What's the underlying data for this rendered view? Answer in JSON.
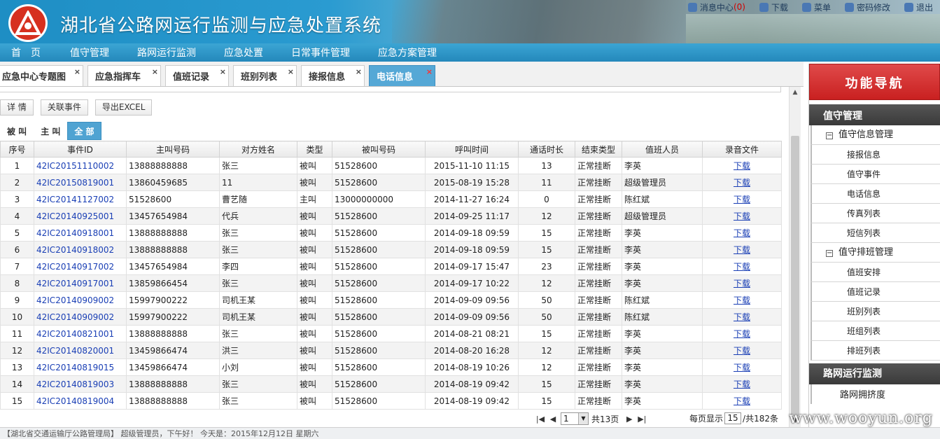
{
  "header": {
    "title": "湖北省公路网运行监测与应急处置系统",
    "toplinks": [
      {
        "label": "消息中心",
        "count": "(0)",
        "icon": "message-icon"
      },
      {
        "label": "下载",
        "icon": "download-icon"
      },
      {
        "label": "菜单",
        "icon": "menu-icon"
      },
      {
        "label": "密码修改",
        "icon": "lock-icon"
      },
      {
        "label": "退出",
        "icon": "exit-icon"
      }
    ]
  },
  "menu": [
    "首　页",
    "值守管理",
    "路网运行监测",
    "应急处置",
    "日常事件管理",
    "应急方案管理"
  ],
  "tabs": [
    "应急中心专题图",
    "应急指挥车",
    "值班记录",
    "班别列表",
    "接报信息",
    "电话信息"
  ],
  "toolbar": {
    "detail": "详 情",
    "related": "关联事件",
    "export": "导出EXCEL"
  },
  "subtabs": [
    "被 叫",
    "主 叫",
    "全 部"
  ],
  "table": {
    "headers": [
      "序号",
      "事件ID",
      "主叫号码",
      "对方姓名",
      "类型",
      "被叫号码",
      "呼叫时间",
      "通话时长",
      "结束类型",
      "值班人员",
      "录音文件"
    ],
    "rows": [
      [
        "1",
        "42IC20151110002",
        "13888888888",
        "张三",
        "被叫",
        "51528600",
        "2015-11-10 11:15",
        "13",
        "正常挂断",
        "李英",
        "下载"
      ],
      [
        "2",
        "42IC20150819001",
        "13860459685",
        "11",
        "被叫",
        "51528600",
        "2015-08-19 15:28",
        "11",
        "正常挂断",
        "超级管理员",
        "下载"
      ],
      [
        "3",
        "42IC20141127002",
        "51528600",
        "曹艺随",
        "主叫",
        "13000000000",
        "2014-11-27 16:24",
        "0",
        "正常挂断",
        "陈红斌",
        "下载"
      ],
      [
        "4",
        "42IC20140925001",
        "13457654984",
        "代兵",
        "被叫",
        "51528600",
        "2014-09-25 11:17",
        "12",
        "正常挂断",
        "超级管理员",
        "下载"
      ],
      [
        "5",
        "42IC20140918001",
        "13888888888",
        "张三",
        "被叫",
        "51528600",
        "2014-09-18 09:59",
        "15",
        "正常挂断",
        "李英",
        "下载"
      ],
      [
        "6",
        "42IC20140918002",
        "13888888888",
        "张三",
        "被叫",
        "51528600",
        "2014-09-18 09:59",
        "15",
        "正常挂断",
        "李英",
        "下载"
      ],
      [
        "7",
        "42IC20140917002",
        "13457654984",
        "李四",
        "被叫",
        "51528600",
        "2014-09-17 15:47",
        "23",
        "正常挂断",
        "李英",
        "下载"
      ],
      [
        "8",
        "42IC20140917001",
        "13859866454",
        "张三",
        "被叫",
        "51528600",
        "2014-09-17 10:22",
        "12",
        "正常挂断",
        "李英",
        "下载"
      ],
      [
        "9",
        "42IC20140909002",
        "15997900222",
        "司机王某",
        "被叫",
        "51528600",
        "2014-09-09 09:56",
        "50",
        "正常挂断",
        "陈红斌",
        "下载"
      ],
      [
        "10",
        "42IC20140909002",
        "15997900222",
        "司机王某",
        "被叫",
        "51528600",
        "2014-09-09 09:56",
        "50",
        "正常挂断",
        "陈红斌",
        "下载"
      ],
      [
        "11",
        "42IC20140821001",
        "13888888888",
        "张三",
        "被叫",
        "51528600",
        "2014-08-21 08:21",
        "15",
        "正常挂断",
        "李英",
        "下载"
      ],
      [
        "12",
        "42IC20140820001",
        "13459866474",
        "洪三",
        "被叫",
        "51528600",
        "2014-08-20 16:28",
        "12",
        "正常挂断",
        "李英",
        "下载"
      ],
      [
        "13",
        "42IC20140819015",
        "13459866474",
        "小刘",
        "被叫",
        "51528600",
        "2014-08-19 10:26",
        "12",
        "正常挂断",
        "李英",
        "下载"
      ],
      [
        "14",
        "42IC20140819003",
        "13888888888",
        "张三",
        "被叫",
        "51528600",
        "2014-08-19 09:42",
        "15",
        "正常挂断",
        "李英",
        "下载"
      ],
      [
        "15",
        "42IC20140819004",
        "13888888888",
        "张三",
        "被叫",
        "51528600",
        "2014-08-19 09:42",
        "15",
        "正常挂断",
        "李英",
        "下载"
      ]
    ]
  },
  "pager": {
    "page": "1",
    "total_pages": "共13页",
    "per_page_label": "每页显示",
    "per_page": "15",
    "total": "/共182条"
  },
  "sidebar": {
    "title": "功能导航",
    "section1": "值守管理",
    "group1": "值守信息管理",
    "group1_items": [
      "接报信息",
      "值守事件",
      "电话信息",
      "传真列表",
      "短信列表"
    ],
    "group2": "值守排班管理",
    "group2_items": [
      "值班安排",
      "值班记录",
      "班别列表",
      "班组列表",
      "排班列表"
    ],
    "section2": "路网运行监测",
    "section2_item": "路网拥挤度"
  },
  "footer": "【湖北省交通运输厅公路管理局】 超级管理员，下午好！ 今天是：2015年12月12日 星期六",
  "watermark": "www.wooyun.org"
}
